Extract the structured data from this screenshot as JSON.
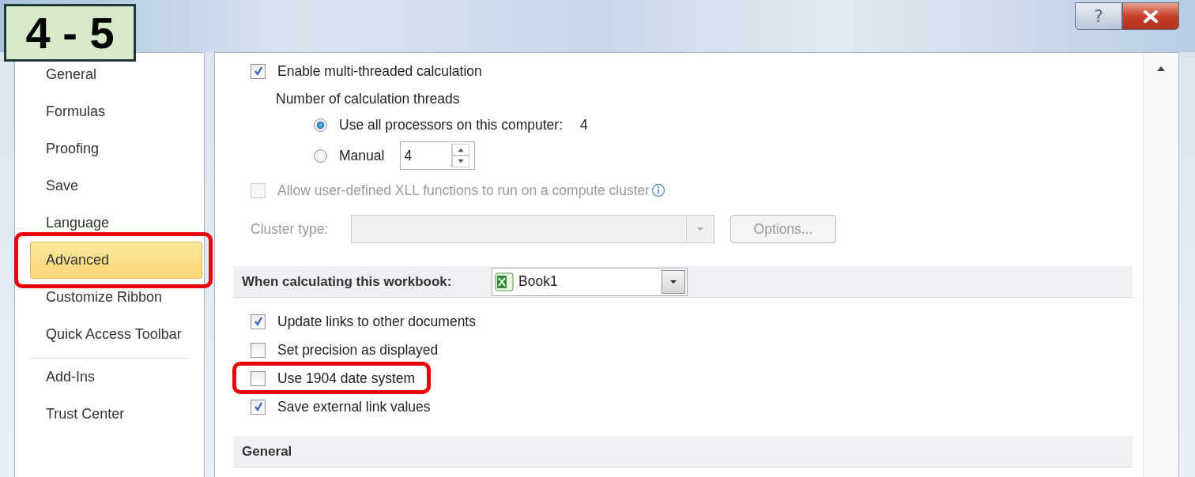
{
  "badge": "4 - 5",
  "window": {
    "help_button": "?"
  },
  "sidebar": {
    "groups": [
      [
        {
          "label": "General",
          "selected": false,
          "highlighted": false
        },
        {
          "label": "Formulas",
          "selected": false,
          "highlighted": false
        },
        {
          "label": "Proofing",
          "selected": false,
          "highlighted": false
        },
        {
          "label": "Save",
          "selected": false,
          "highlighted": false
        },
        {
          "label": "Language",
          "selected": false,
          "highlighted": false
        },
        {
          "label": "Advanced",
          "selected": true,
          "highlighted": true
        },
        {
          "label": "Customize Ribbon",
          "selected": false,
          "highlighted": false
        },
        {
          "label": "Quick Access Toolbar",
          "selected": false,
          "highlighted": false
        }
      ],
      [
        {
          "label": "Add-Ins",
          "selected": false,
          "highlighted": false
        },
        {
          "label": "Trust Center",
          "selected": false,
          "highlighted": false
        }
      ]
    ]
  },
  "calculation": {
    "multithread": {
      "label": "Enable multi-threaded calculation",
      "checked": true,
      "disabled": false
    },
    "threads_label": "Number of calculation threads",
    "thread_options": [
      {
        "label": "Use all processors on this computer:",
        "value": "4",
        "selected": true
      },
      {
        "label": "Manual",
        "spinner": "4",
        "selected": false
      }
    ],
    "xll": {
      "label": "Allow user-defined XLL functions to run on a compute cluster",
      "checked": false,
      "disabled": true
    },
    "cluster_type": {
      "label": "Cluster type:",
      "disabled": true
    },
    "options_button": {
      "label": "Options...",
      "disabled": true
    }
  },
  "workbook_section": {
    "title": "When calculating this workbook:",
    "workbook": "Book1",
    "options": [
      {
        "label": "Update links to other documents",
        "checked": true,
        "highlighted": false
      },
      {
        "label": "Set precision as displayed",
        "checked": false,
        "highlighted": false
      },
      {
        "label": "Use 1904 date system",
        "checked": false,
        "highlighted": true
      },
      {
        "label": "Save external link values",
        "checked": true,
        "highlighted": false
      }
    ]
  },
  "general_section": {
    "title": "General"
  }
}
